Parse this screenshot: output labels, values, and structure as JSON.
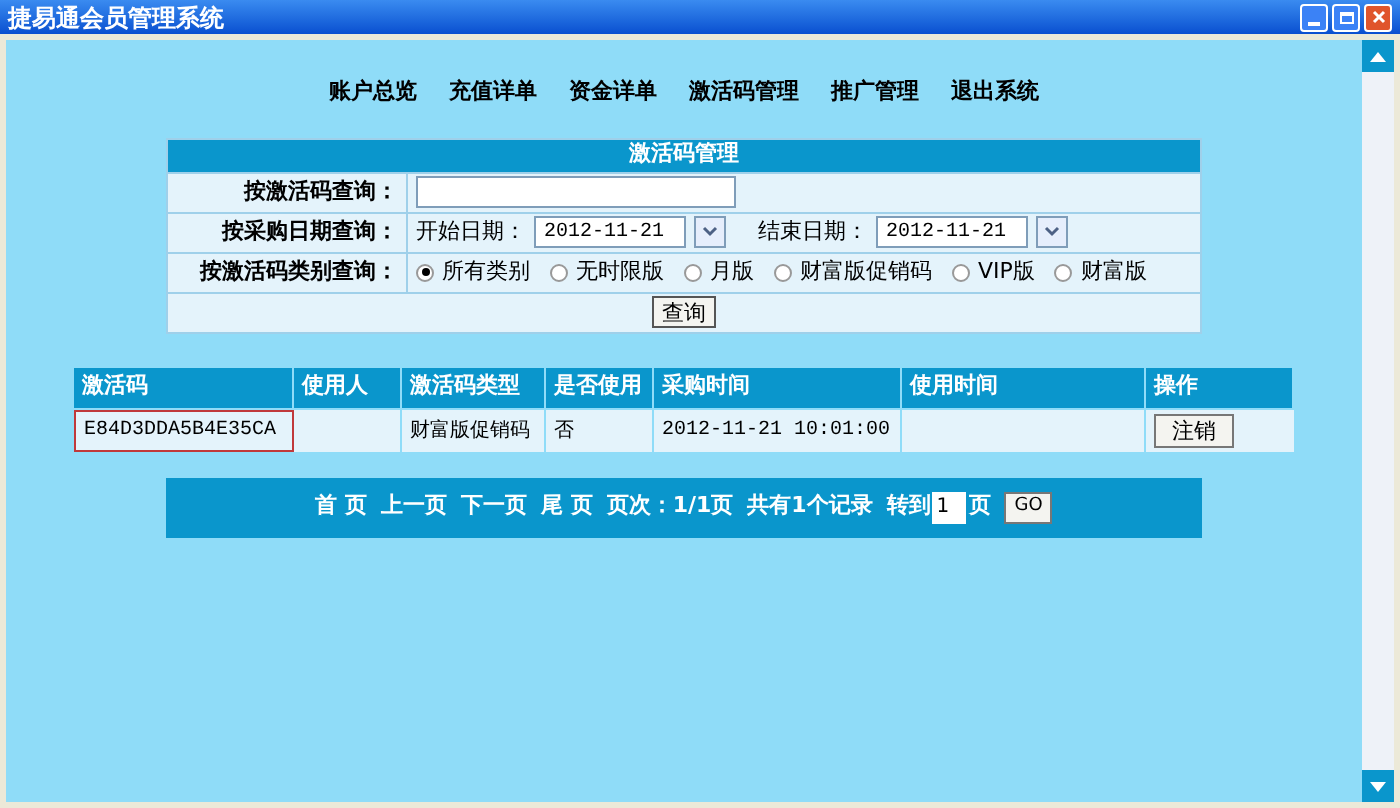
{
  "window": {
    "title": "捷易通会员管理系统"
  },
  "nav": [
    "账户总览",
    "充值详单",
    "资金详单",
    "激活码管理",
    "推广管理",
    "退出系统"
  ],
  "query": {
    "title": "激活码管理",
    "rows": [
      {
        "kind": "text",
        "label": "按激活码查询："
      },
      {
        "kind": "dates",
        "label": "按采购日期查询：",
        "start_label": "开始日期：",
        "start_value": "2012-11-21",
        "end_label": "结束日期：",
        "end_value": "2012-11-21"
      },
      {
        "kind": "radios",
        "label": "按激活码类别查询：",
        "options": [
          {
            "label": "所有类别",
            "selected": true
          },
          {
            "label": "无时限版",
            "selected": false
          },
          {
            "label": "月版",
            "selected": false
          },
          {
            "label": "财富版促销码",
            "selected": false
          },
          {
            "label": "VIP版",
            "selected": false
          },
          {
            "label": "财富版",
            "selected": false
          }
        ]
      }
    ],
    "button": "查询"
  },
  "table": {
    "columns": [
      "激活码",
      "使用人",
      "激活码类型",
      "是否使用",
      "采购时间",
      "使用时间",
      "操作"
    ],
    "rows": [
      {
        "cells": [
          "E84D3DDA5B4E35CA",
          "",
          "财富版促销码",
          "否",
          "2012-11-21 10:01:00",
          ""
        ],
        "action": "注销",
        "selected": true
      }
    ]
  },
  "pager": {
    "links": [
      "首 页",
      "上一页",
      "下一页",
      "尾 页"
    ],
    "page_info": "页次：1/1页",
    "total": "共有1个记录",
    "goto": "转到",
    "page_value": "1",
    "page_suffix": "页",
    "go": "GO"
  }
}
